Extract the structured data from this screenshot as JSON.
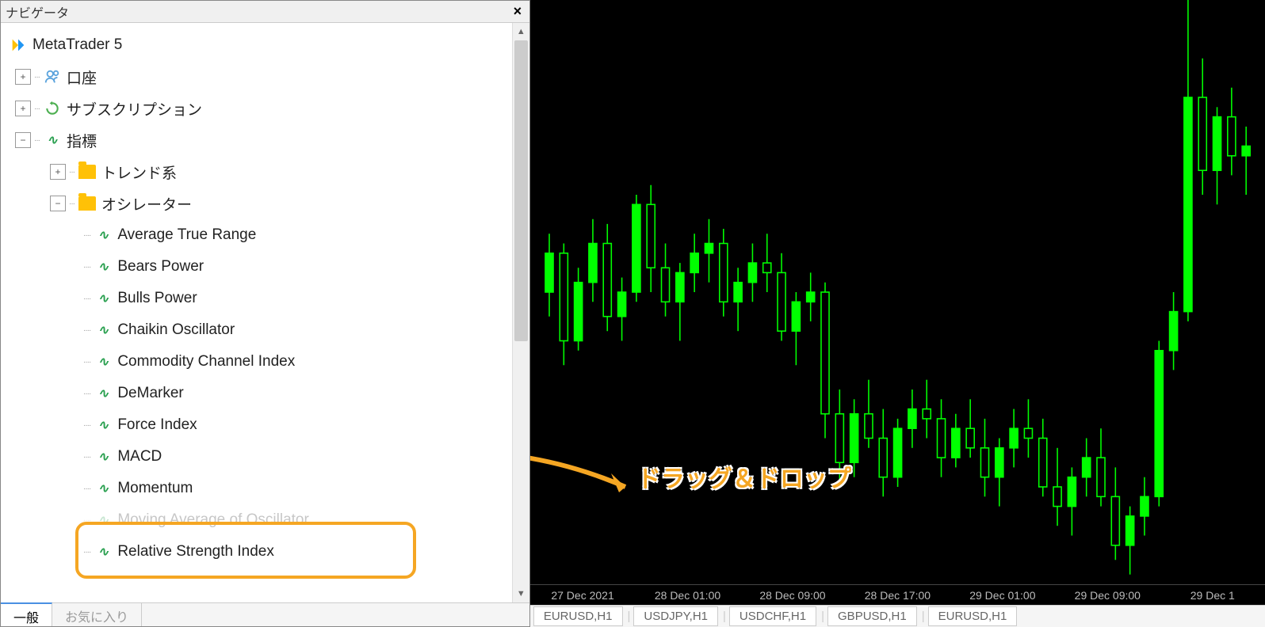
{
  "navigator": {
    "title": "ナビゲータ",
    "root": "MetaTrader 5",
    "accounts": "口座",
    "subscriptions": "サブスクリプション",
    "indicators": "指標",
    "trend": "トレンド系",
    "oscillators": "オシレーター",
    "osc_items": [
      "Average True Range",
      "Bears Power",
      "Bulls Power",
      "Chaikin Oscillator",
      "Commodity Channel Index",
      "DeMarker",
      "Force Index",
      "MACD",
      "Momentum",
      "Moving Average of Oscillator",
      "Relative Strength Index"
    ],
    "highlighted_index": 10,
    "tabs": {
      "general": "一般",
      "favorites": "お気に入り"
    }
  },
  "annotation": {
    "text": "ドラッグ＆ドロップ"
  },
  "chart_data": {
    "type": "candlestick",
    "ylim": [
      1.126,
      1.138
    ],
    "time_labels": [
      "27 Dec 2021",
      "28 Dec 01:00",
      "28 Dec 09:00",
      "28 Dec 17:00",
      "29 Dec 01:00",
      "29 Dec 09:00",
      "29 Dec 1"
    ],
    "candles": [
      {
        "o": 1.132,
        "h": 1.1332,
        "l": 1.1315,
        "c": 1.1328
      },
      {
        "o": 1.1328,
        "h": 1.133,
        "l": 1.1305,
        "c": 1.131
      },
      {
        "o": 1.131,
        "h": 1.1325,
        "l": 1.1308,
        "c": 1.1322
      },
      {
        "o": 1.1322,
        "h": 1.1335,
        "l": 1.1318,
        "c": 1.133
      },
      {
        "o": 1.133,
        "h": 1.1334,
        "l": 1.1312,
        "c": 1.1315
      },
      {
        "o": 1.1315,
        "h": 1.1323,
        "l": 1.131,
        "c": 1.132
      },
      {
        "o": 1.132,
        "h": 1.134,
        "l": 1.1318,
        "c": 1.1338
      },
      {
        "o": 1.1338,
        "h": 1.1342,
        "l": 1.132,
        "c": 1.1325
      },
      {
        "o": 1.1325,
        "h": 1.133,
        "l": 1.1315,
        "c": 1.1318
      },
      {
        "o": 1.1318,
        "h": 1.1326,
        "l": 1.131,
        "c": 1.1324
      },
      {
        "o": 1.1324,
        "h": 1.1332,
        "l": 1.132,
        "c": 1.1328
      },
      {
        "o": 1.1328,
        "h": 1.1335,
        "l": 1.1322,
        "c": 1.133
      },
      {
        "o": 1.133,
        "h": 1.1333,
        "l": 1.1315,
        "c": 1.1318
      },
      {
        "o": 1.1318,
        "h": 1.1325,
        "l": 1.1312,
        "c": 1.1322
      },
      {
        "o": 1.1322,
        "h": 1.133,
        "l": 1.1318,
        "c": 1.1326
      },
      {
        "o": 1.1326,
        "h": 1.1332,
        "l": 1.132,
        "c": 1.1324
      },
      {
        "o": 1.1324,
        "h": 1.1328,
        "l": 1.131,
        "c": 1.1312
      },
      {
        "o": 1.1312,
        "h": 1.132,
        "l": 1.1305,
        "c": 1.1318
      },
      {
        "o": 1.1318,
        "h": 1.1324,
        "l": 1.1314,
        "c": 1.132
      },
      {
        "o": 1.132,
        "h": 1.1322,
        "l": 1.129,
        "c": 1.1295
      },
      {
        "o": 1.1295,
        "h": 1.13,
        "l": 1.128,
        "c": 1.1285
      },
      {
        "o": 1.1285,
        "h": 1.1298,
        "l": 1.1282,
        "c": 1.1295
      },
      {
        "o": 1.1295,
        "h": 1.1302,
        "l": 1.1288,
        "c": 1.129
      },
      {
        "o": 1.129,
        "h": 1.1296,
        "l": 1.1278,
        "c": 1.1282
      },
      {
        "o": 1.1282,
        "h": 1.1294,
        "l": 1.128,
        "c": 1.1292
      },
      {
        "o": 1.1292,
        "h": 1.13,
        "l": 1.1288,
        "c": 1.1296
      },
      {
        "o": 1.1296,
        "h": 1.1302,
        "l": 1.129,
        "c": 1.1294
      },
      {
        "o": 1.1294,
        "h": 1.1298,
        "l": 1.1282,
        "c": 1.1286
      },
      {
        "o": 1.1286,
        "h": 1.1295,
        "l": 1.1284,
        "c": 1.1292
      },
      {
        "o": 1.1292,
        "h": 1.1298,
        "l": 1.1286,
        "c": 1.1288
      },
      {
        "o": 1.1288,
        "h": 1.1294,
        "l": 1.1278,
        "c": 1.1282
      },
      {
        "o": 1.1282,
        "h": 1.129,
        "l": 1.1276,
        "c": 1.1288
      },
      {
        "o": 1.1288,
        "h": 1.1296,
        "l": 1.1284,
        "c": 1.1292
      },
      {
        "o": 1.1292,
        "h": 1.1298,
        "l": 1.1286,
        "c": 1.129
      },
      {
        "o": 1.129,
        "h": 1.1294,
        "l": 1.1278,
        "c": 1.128
      },
      {
        "o": 1.128,
        "h": 1.1288,
        "l": 1.1272,
        "c": 1.1276
      },
      {
        "o": 1.1276,
        "h": 1.1284,
        "l": 1.127,
        "c": 1.1282
      },
      {
        "o": 1.1282,
        "h": 1.129,
        "l": 1.1278,
        "c": 1.1286
      },
      {
        "o": 1.1286,
        "h": 1.1292,
        "l": 1.1276,
        "c": 1.1278
      },
      {
        "o": 1.1278,
        "h": 1.1284,
        "l": 1.1265,
        "c": 1.1268
      },
      {
        "o": 1.1268,
        "h": 1.1276,
        "l": 1.1262,
        "c": 1.1274
      },
      {
        "o": 1.1274,
        "h": 1.1282,
        "l": 1.127,
        "c": 1.1278
      },
      {
        "o": 1.1278,
        "h": 1.131,
        "l": 1.1276,
        "c": 1.1308
      },
      {
        "o": 1.1308,
        "h": 1.132,
        "l": 1.1304,
        "c": 1.1316
      },
      {
        "o": 1.1316,
        "h": 1.138,
        "l": 1.1314,
        "c": 1.136
      },
      {
        "o": 1.136,
        "h": 1.1368,
        "l": 1.134,
        "c": 1.1345
      },
      {
        "o": 1.1345,
        "h": 1.1358,
        "l": 1.1338,
        "c": 1.1356
      },
      {
        "o": 1.1356,
        "h": 1.1362,
        "l": 1.1344,
        "c": 1.1348
      },
      {
        "o": 1.1348,
        "h": 1.1354,
        "l": 1.134,
        "c": 1.135
      }
    ]
  },
  "chart_tabs": [
    "EURUSD,H1",
    "USDJPY,H1",
    "USDCHF,H1",
    "GBPUSD,H1",
    "EURUSD,H1"
  ]
}
